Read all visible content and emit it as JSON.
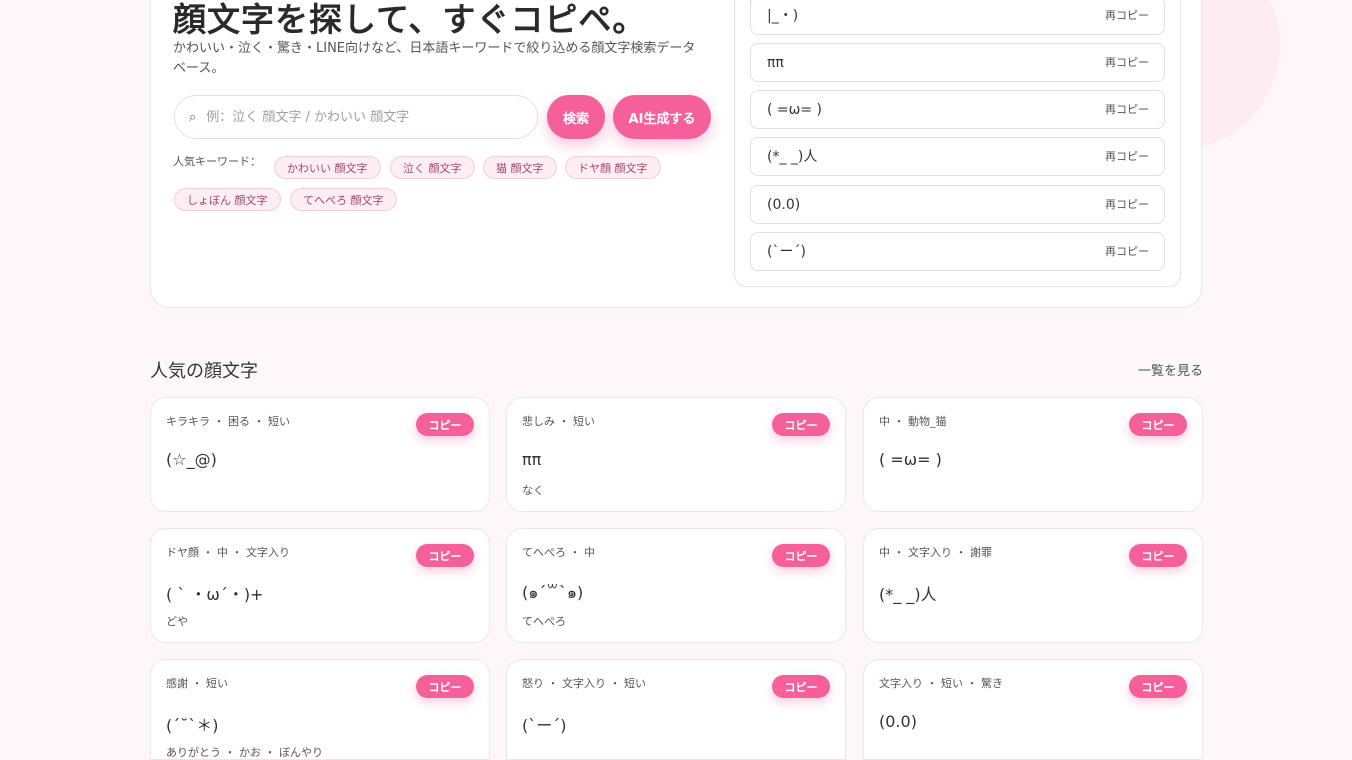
{
  "hero": {
    "title": "顔文字を探して、すぐコピペ。",
    "subtitle": "かわいい・泣く・驚き・LINE向けなど、日本語キーワードで絞り込める顔文字検索データベース。",
    "search": {
      "icon": "search-icon",
      "placeholder": "例：泣く 顔文字 / かわいい 顔文字",
      "value": ""
    },
    "search_button": "検索",
    "ai_button": "AI生成する",
    "keywords_label": "人気キーワード：",
    "keywords": [
      "かわいい 顔文字",
      "泣く 顔文字",
      "猫 顔文字",
      "ドヤ顔 顔文字",
      "しょぼん 顔文字",
      "てへぺろ 顔文字"
    ]
  },
  "recent": [
    {
      "face": "|_・)",
      "copy": "再コピー"
    },
    {
      "face": "ππ",
      "copy": "再コピー"
    },
    {
      "face": "(  =ω=  )",
      "copy": "再コピー"
    },
    {
      "face": "(*_ _)人",
      "copy": "再コピー"
    },
    {
      "face": "(0.0)",
      "copy": "再コピー"
    },
    {
      "face": "(`ー´)",
      "copy": "再コピー"
    }
  ],
  "popular": {
    "title": "人気の顔文字",
    "see_all": "一覧を見る",
    "cards": [
      {
        "tags": "キラキラ ・ 困る ・ 短い",
        "face": "(☆_@)",
        "reading": "",
        "copy": "コピー"
      },
      {
        "tags": "悲しみ ・ 短い",
        "face": "ππ",
        "reading": "なく",
        "copy": "コピー"
      },
      {
        "tags": "中 ・ 動物_猫",
        "face": "(  =ω=  )",
        "reading": "",
        "copy": "コピー"
      },
      {
        "tags": "ドヤ顔 ・ 中 ・ 文字入り",
        "face": "( ` ・ω´・)+",
        "reading": "どや",
        "copy": "コピー"
      },
      {
        "tags": "てへぺろ ・ 中",
        "face": "(๑ˊ꒳ˋ๑)",
        "reading": "てへぺろ",
        "copy": "コピー"
      },
      {
        "tags": "中 ・ 文字入り ・ 謝罪",
        "face": "(*_ _)人",
        "reading": "",
        "copy": "コピー"
      },
      {
        "tags": "感謝 ・ 短い",
        "face": "(´˘`＊)",
        "reading": "ありがとう ・ かお ・ ぼんやり",
        "copy": "コピー"
      },
      {
        "tags": "怒り ・ 文字入り ・ 短い",
        "face": "(`ー´)",
        "reading": "",
        "copy": "コピー"
      },
      {
        "tags": "文字入り ・ 短い ・ 驚き",
        "face": "(0.0)",
        "reading": "",
        "copy": "コピー"
      }
    ]
  },
  "colors": {
    "accent": "#f5609a",
    "chip_bg": "#fdeef3",
    "page_bg": "#fdf7f9"
  }
}
